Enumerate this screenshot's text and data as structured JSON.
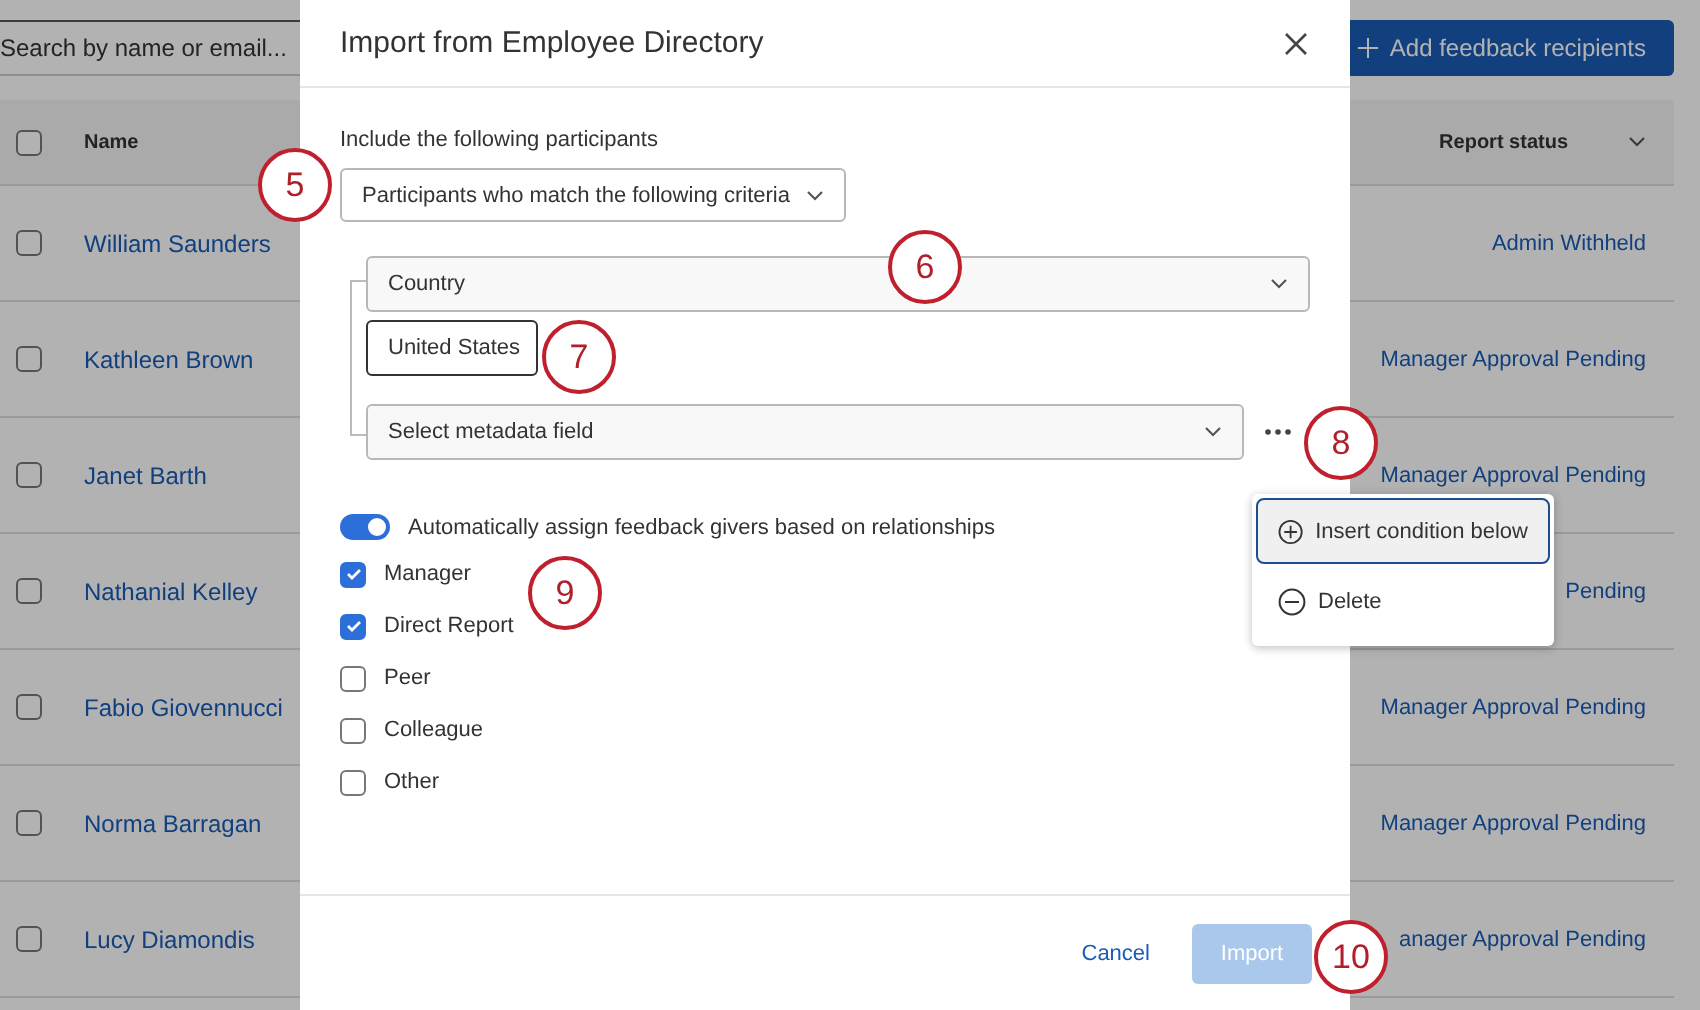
{
  "background": {
    "search": {
      "placeholder": "Search by name or email..."
    },
    "add_button": {
      "label": "Add feedback recipients"
    },
    "table": {
      "all_checked": false,
      "columns": [
        "Name",
        "Report status"
      ],
      "rows": [
        {
          "name": "William Saunders",
          "report_status": "Admin Withheld",
          "checked": false
        },
        {
          "name": "Kathleen Brown",
          "report_status": "Manager Approval Pending",
          "checked": false
        },
        {
          "name": "Janet Barth",
          "report_status": "Manager Approval Pending",
          "checked": false
        },
        {
          "name": "Nathanial Kelley",
          "report_status": "Pending",
          "checked": false
        },
        {
          "name": "Fabio Giovennucci",
          "report_status": "Manager Approval Pending",
          "checked": false
        },
        {
          "name": "Norma Barragan",
          "report_status": "Manager Approval Pending",
          "checked": false
        },
        {
          "name": "Lucy Diamondis",
          "report_status": "anager Approval Pending",
          "checked": false
        }
      ]
    }
  },
  "dialog": {
    "title": "Import from Employee Directory",
    "include_label": "Include the following participants",
    "include_select": "Participants who match the following criteria",
    "conditions": {
      "field": "Country",
      "value": "United States",
      "next_field_placeholder": "Select metadata field"
    },
    "auto_assign": {
      "label": "Automatically assign feedback givers based on relationships",
      "on": true
    },
    "relationships": [
      {
        "label": "Manager",
        "checked": true
      },
      {
        "label": "Direct Report",
        "checked": true
      },
      {
        "label": "Peer",
        "checked": false
      },
      {
        "label": "Colleague",
        "checked": false
      },
      {
        "label": "Other",
        "checked": false
      }
    ],
    "cancel": "Cancel",
    "import": {
      "label": "Import",
      "disabled": true
    }
  },
  "menu": {
    "items": [
      {
        "kind": "insert",
        "label": "Insert condition below",
        "selected": true
      },
      {
        "kind": "delete",
        "label": "Delete",
        "selected": false
      }
    ]
  },
  "callouts": [
    "5",
    "6",
    "7",
    "8",
    "9",
    "10"
  ]
}
